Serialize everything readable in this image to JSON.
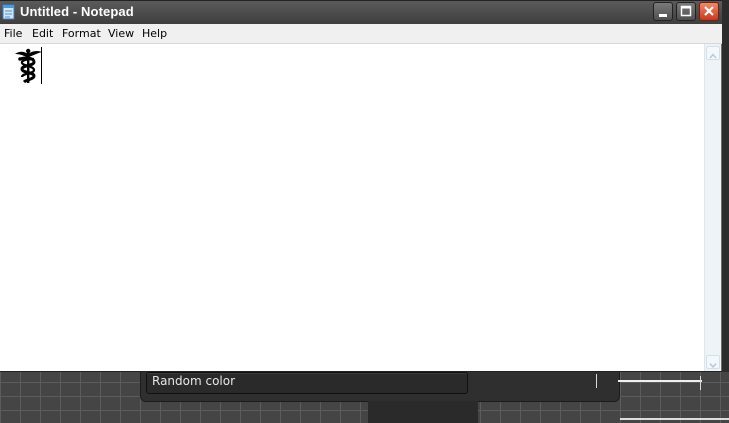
{
  "window": {
    "title": "Untitled - Notepad"
  },
  "menu": {
    "items": [
      "File",
      "Edit",
      "Format",
      "View",
      "Help"
    ]
  },
  "editor": {
    "content_glyph": "caduceus-icon"
  },
  "background_app": {
    "button_label": "Random color"
  },
  "icons": {
    "app": "notepad-icon",
    "minimize": "minimize-icon",
    "maximize": "maximize-icon",
    "close": "close-icon",
    "scroll_up": "chevron-up-icon",
    "scroll_down": "chevron-down-icon"
  },
  "colors": {
    "titlebar": "#4a4a4a",
    "close_button": "#d9492a",
    "editor_bg": "#ffffff",
    "menubar_bg": "#f0f0f0"
  }
}
